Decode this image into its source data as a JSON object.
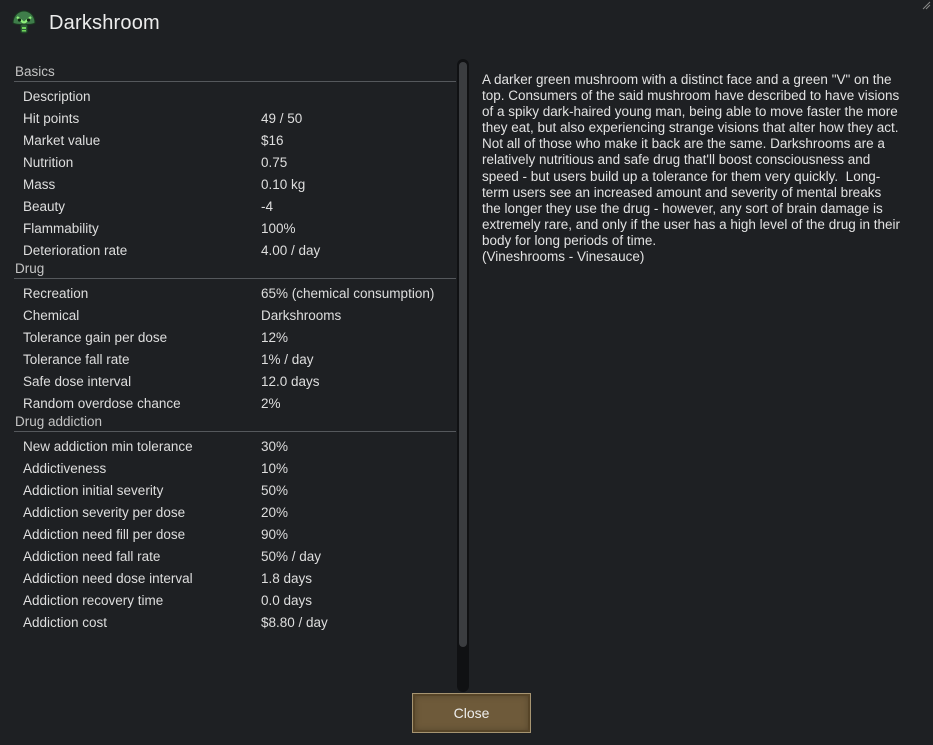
{
  "window": {
    "title": "Darkshroom",
    "icon": "mushroom-icon",
    "corner_icon": "resize-grip-icon"
  },
  "sections": [
    {
      "header": "Basics",
      "rows": [
        {
          "label": "Description",
          "value": ""
        },
        {
          "label": "Hit points",
          "value": "49 / 50"
        },
        {
          "label": "Market value",
          "value": "$16"
        },
        {
          "label": "Nutrition",
          "value": "0.75"
        },
        {
          "label": "Mass",
          "value": "0.10 kg"
        },
        {
          "label": "Beauty",
          "value": "-4"
        },
        {
          "label": "Flammability",
          "value": "100%"
        },
        {
          "label": "Deterioration rate",
          "value": "4.00 / day"
        }
      ]
    },
    {
      "header": "Drug",
      "rows": [
        {
          "label": "Recreation",
          "value": "65% (chemical consumption)"
        },
        {
          "label": "Chemical",
          "value": "Darkshrooms"
        },
        {
          "label": "Tolerance gain per dose",
          "value": "12%"
        },
        {
          "label": "Tolerance fall rate",
          "value": "1% / day"
        },
        {
          "label": "Safe dose interval",
          "value": "12.0 days"
        },
        {
          "label": "Random overdose chance",
          "value": "2%"
        }
      ]
    },
    {
      "header": "Drug addiction",
      "rows": [
        {
          "label": "New addiction min tolerance",
          "value": "30%"
        },
        {
          "label": "Addictiveness",
          "value": "10%"
        },
        {
          "label": "Addiction initial severity",
          "value": "50%"
        },
        {
          "label": "Addiction severity per dose",
          "value": "20%"
        },
        {
          "label": "Addiction need fill per dose",
          "value": "90%"
        },
        {
          "label": "Addiction need fall rate",
          "value": "50% / day"
        },
        {
          "label": "Addiction need dose interval",
          "value": "1.8 days"
        },
        {
          "label": "Addiction recovery time",
          "value": "0.0 days"
        },
        {
          "label": "Addiction cost",
          "value": "$8.80 / day"
        }
      ]
    }
  ],
  "description": "A darker green mushroom with a distinct face and a green \"V\" on the top. Consumers of the said mushroom have described to have visions of a spiky dark-haired young man, being able to move faster the more they eat, but also experiencing strange visions that alter how they act. Not all of those who make it back are the same. Darkshrooms are a relatively nutritious and safe drug that'll boost consciousness and speed - but users build up a tolerance for them very quickly.  Long-term users see an increased amount and severity of mental breaks the longer they use the drug - however, any sort of brain damage is extremely rare, and only if the user has a high level of the drug in their body for long periods of time.\n(Vineshrooms - Vinesauce)",
  "buttons": {
    "close": "Close"
  },
  "colors": {
    "background": "#1e2023",
    "button": "#6e5a3a",
    "button_border": "#a69471",
    "icon_green": "#6fd65a"
  }
}
